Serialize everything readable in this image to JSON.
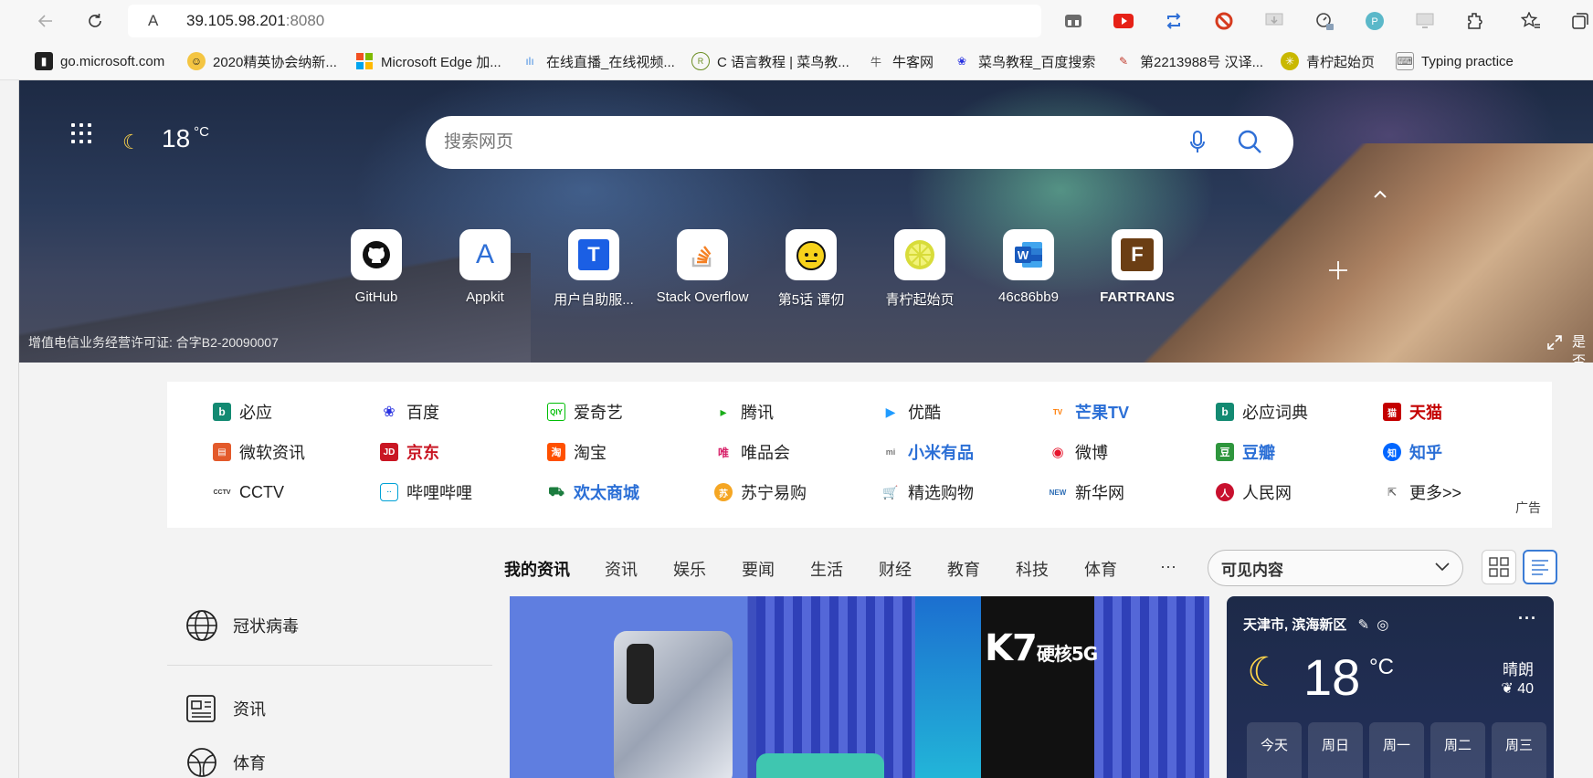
{
  "browser": {
    "url_host": "39.105.98.201",
    "url_port": ":8080",
    "site_icon_glyph": "A"
  },
  "favorites": [
    {
      "label": "go.microsoft.com",
      "icon": "microsoft-icon",
      "color": "#222222"
    },
    {
      "label": "2020精英协会纳新...",
      "icon": "emoji-icon",
      "color": "#f4c542"
    },
    {
      "label": "Microsoft Edge 加...",
      "icon": "windows-logo-icon",
      "color": "#f25022"
    },
    {
      "label": "在线直播_在线视频...",
      "icon": "audio-wave-icon",
      "color": "#4a90e2"
    },
    {
      "label": "C 语言教程 | 菜鸟教...",
      "icon": "runoob-icon",
      "color": "#6b8e23"
    },
    {
      "label": "牛客网",
      "icon": "nowcoder-icon",
      "color": "#555555"
    },
    {
      "label": "菜鸟教程_百度搜索",
      "icon": "baidu-paw-icon",
      "color": "#2932e1"
    },
    {
      "label": "第2213988号 汉译...",
      "icon": "youdao-icon",
      "color": "#c0392b"
    },
    {
      "label": "青柠起始页",
      "icon": "lemon-icon",
      "color": "#c9b800"
    },
    {
      "label": "Typing practice",
      "icon": "keyboard-icon",
      "color": "#666666"
    }
  ],
  "hero": {
    "weather_temp": "18",
    "weather_unit": "°C",
    "search_placeholder": "搜索网页",
    "license": "增值电信业务经营许可证: 合字B2-20090007",
    "expand_text": "是否",
    "tiles": [
      {
        "label": "GitHub",
        "glyph": "",
        "icon": "github-icon",
        "bg": "#ffffff",
        "fg": "#111111"
      },
      {
        "label": "Appkit",
        "glyph": "A",
        "icon": "appkit-icon",
        "bg": "#ffffff",
        "fg": "#2f6fd6"
      },
      {
        "label": "用户自助服...",
        "glyph": "T",
        "icon": "t-icon",
        "bg": "#1b5fe4",
        "fg": "#ffffff"
      },
      {
        "label": "Stack Overflow",
        "glyph": "",
        "icon": "stackoverflow-icon",
        "bg": "#ffffff",
        "fg": "#f48024"
      },
      {
        "label": "第5话 谭仞",
        "glyph": "",
        "icon": "cartoon-face-icon",
        "bg": "#f7d21b",
        "fg": "#111111"
      },
      {
        "label": "青柠起始页",
        "glyph": "",
        "icon": "lemon-icon",
        "bg": "#d8dc3a",
        "fg": "#ffffff"
      },
      {
        "label": "46c86bb9",
        "glyph": "W",
        "icon": "word-icon",
        "bg": "#185abd",
        "fg": "#ffffff"
      },
      {
        "label": "FARTRANS",
        "glyph": "F",
        "icon": "fartrans-icon",
        "bg": "#6b3e14",
        "fg": "#ffffff"
      }
    ]
  },
  "quick_links": [
    {
      "label": "必应",
      "icon": "bing-icon",
      "color": "#138a72",
      "bold": false
    },
    {
      "label": "百度",
      "icon": "baidu-paw-icon",
      "color": "#2932e1",
      "bold": false
    },
    {
      "label": "爱奇艺",
      "icon": "iqiyi-icon",
      "color": "#00be06",
      "bold": false
    },
    {
      "label": "腾讯",
      "icon": "tencent-icon",
      "color": "#1aad19",
      "bold": false
    },
    {
      "label": "优酷",
      "icon": "youku-icon",
      "color": "#1f9bff",
      "bold": false
    },
    {
      "label": "芒果TV",
      "icon": "mangotv-icon",
      "color": "#ff7a00",
      "bold": true,
      "text_color": "#2b6fd6"
    },
    {
      "label": "必应词典",
      "icon": "bing-icon",
      "color": "#138a72",
      "bold": false
    },
    {
      "label": "天猫",
      "icon": "tmall-icon",
      "color": "#c40000",
      "bold": true,
      "text_color": "#c40000"
    },
    {
      "label": "微软资讯",
      "icon": "msn-icon",
      "color": "#e35a2b",
      "bold": false
    },
    {
      "label": "京东",
      "icon": "jd-icon",
      "color": "#c91623",
      "bold": true,
      "text_color": "#c91623"
    },
    {
      "label": "淘宝",
      "icon": "taobao-icon",
      "color": "#ff5000",
      "bold": false
    },
    {
      "label": "唯品会",
      "icon": "vip-icon",
      "color": "#d8246b",
      "bold": false
    },
    {
      "label": "小米有品",
      "icon": "xiaomi-icon",
      "color": "#777777",
      "bold": true,
      "text_color": "#2b6fd6"
    },
    {
      "label": "微博",
      "icon": "weibo-icon",
      "color": "#e6162d",
      "bold": false
    },
    {
      "label": "豆瓣",
      "icon": "douban-icon",
      "color": "#2e963d",
      "bold": true,
      "text_color": "#2b6fd6"
    },
    {
      "label": "知乎",
      "icon": "zhihu-icon",
      "color": "#0066ff",
      "bold": true,
      "text_color": "#2b6fd6"
    },
    {
      "label": "CCTV",
      "icon": "cctv-icon",
      "color": "#333333",
      "bold": false
    },
    {
      "label": "哔哩哔哩",
      "icon": "bilibili-icon",
      "color": "#00a1d6",
      "bold": false
    },
    {
      "label": "欢太商城",
      "icon": "heytap-icon",
      "color": "#1b7c3e",
      "bold": true,
      "text_color": "#2b6fd6"
    },
    {
      "label": "苏宁易购",
      "icon": "suning-icon",
      "color": "#f5a623",
      "bold": false
    },
    {
      "label": "精选购物",
      "icon": "shopping-cart-icon",
      "color": "#e67e22",
      "bold": false
    },
    {
      "label": "新华网",
      "icon": "xinhua-icon",
      "color": "#2d6db5",
      "bold": false
    },
    {
      "label": "人民网",
      "icon": "people-icon",
      "color": "#c8102e",
      "bold": false
    },
    {
      "label": "更多>>",
      "icon": "more-icon",
      "color": "#666666",
      "bold": false
    }
  ],
  "quick_links_ad": "广告",
  "feed_tabs": [
    {
      "label": "我的资讯",
      "active": true
    },
    {
      "label": "资讯",
      "active": false
    },
    {
      "label": "娱乐",
      "active": false
    },
    {
      "label": "要闻",
      "active": false
    },
    {
      "label": "生活",
      "active": false
    },
    {
      "label": "财经",
      "active": false
    },
    {
      "label": "教育",
      "active": false
    },
    {
      "label": "科技",
      "active": false
    },
    {
      "label": "体育",
      "active": false
    },
    {
      "label": "···",
      "active": false
    }
  ],
  "visible_content": "可见内容",
  "left_menu": [
    {
      "label": "冠状病毒",
      "icon": "globe-icon"
    },
    {
      "label": "资讯",
      "icon": "newspaper-icon"
    },
    {
      "label": "体育",
      "icon": "sports-ball-icon"
    }
  ],
  "news_card": {
    "headline_graphic_text": "K7",
    "graphic_subtext": "硬核5G"
  },
  "weather_card": {
    "location": "天津市, 滨海新区",
    "more": "···",
    "temp": "18",
    "unit": "°C",
    "condition": "晴朗",
    "aqi": "40",
    "days": [
      "今天",
      "周日",
      "周一",
      "周二",
      "周三"
    ]
  }
}
